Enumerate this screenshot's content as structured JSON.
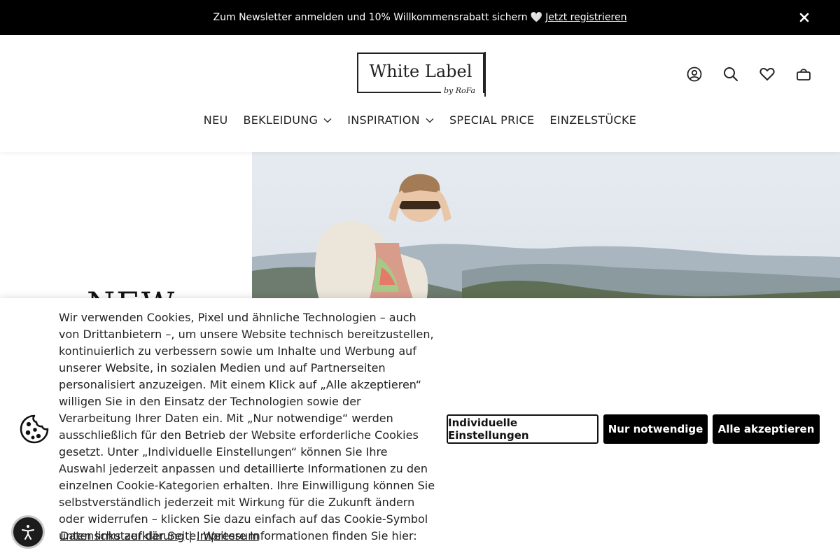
{
  "announcement": {
    "text": "Zum Newsletter anmelden und 10% Willkommensrabatt sichern",
    "heart": "🤍",
    "link_label": "Jetzt registrieren",
    "close_icon": "close-icon"
  },
  "header": {
    "logo": {
      "name": "White Label",
      "byline": "by RoFa"
    },
    "icons": [
      "account-icon",
      "search-icon",
      "wishlist-heart-icon",
      "cart-bag-icon"
    ]
  },
  "nav": {
    "items": [
      {
        "label": "NEU",
        "has_dropdown": false
      },
      {
        "label": "BEKLEIDUNG",
        "has_dropdown": true
      },
      {
        "label": "INSPIRATION",
        "has_dropdown": true
      },
      {
        "label": "SPECIAL PRICE",
        "has_dropdown": false
      },
      {
        "label": "EINZELSTÜCKE",
        "has_dropdown": false
      }
    ]
  },
  "hero": {
    "headline": "NEW"
  },
  "cookie": {
    "text": "Wir verwenden Cookies, Pixel und ähnliche Technologien – auch von Drittanbietern –, um unsere Website technisch bereitzustellen, kontinuierlich zu verbessern sowie um Inhalte und Werbung auf unserer Website, in sozialen Medien und auf Partnerseiten personalisiert anzuzeigen. Mit einem Klick auf „Alle akzeptieren“ willigen Sie in den Einsatz der Technologien sowie der Verarbeitung Ihrer Daten ein. Mit „Nur notwendige“ werden ausschließlich für den Betrieb der Website erforderliche Cookies gesetzt. Unter „Individuelle Einstellungen“ können Sie Ihre Auswahl jederzeit anpassen und detaillierte Informationen zu den einzelnen Cookie-Kategorien erhalten. Ihre Einwilligung können Sie selbstverständlich jederzeit mit Wirkung für die Zukunft ändern oder widerrufen – klicken Sie dazu einfach auf das Cookie-Symbol unten links auf der Seite. Weitere Informationen finden Sie hier:",
    "privacy_link": "Datenschutzerklärung",
    "separator": "|",
    "imprint_link": "Impressum",
    "buttons": {
      "individual": "Individuelle Einstellungen",
      "necessary": "Nur notwendige",
      "accept_all": "Alle akzeptieren"
    }
  },
  "colors": {
    "black": "#000000",
    "white": "#ffffff",
    "text": "#222222"
  }
}
